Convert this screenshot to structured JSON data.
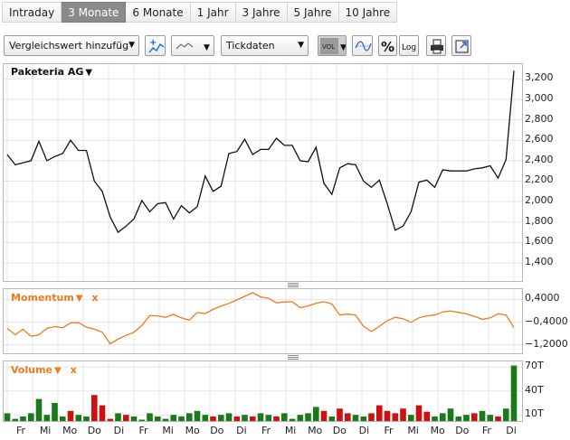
{
  "tabs": [
    {
      "label": "Intraday",
      "active": false
    },
    {
      "label": "3 Monate",
      "active": true
    },
    {
      "label": "6 Monate",
      "active": false
    },
    {
      "label": "1 Jahr",
      "active": false
    },
    {
      "label": "3 Jahre",
      "active": false
    },
    {
      "label": "5 Jahre",
      "active": false
    },
    {
      "label": "10 Jahre",
      "active": false
    }
  ],
  "toolbar": {
    "compare_label": "Vergleichswert hinzufüg",
    "tick_label": "Tickdaten",
    "vol_label": "VOL",
    "log_label": "Log",
    "percent_label": "%"
  },
  "colors": {
    "price_line": "#111111",
    "momentum_line": "#f07a1a",
    "label_orange": "#f07a1a",
    "vol_up": "#1a7a1a",
    "vol_down": "#cc1111",
    "grid": "#e5e5e5"
  },
  "chart_data": [
    {
      "panel": "price",
      "type": "line",
      "title": "Paketeria AG",
      "ylim": [
        1250,
        3300
      ],
      "yticks": [
        "3,200",
        "3,000",
        "2,800",
        "2,600",
        "2,400",
        "2,200",
        "2,000",
        "1,800",
        "1,600",
        "1,400"
      ],
      "ytick_values": [
        3200,
        3000,
        2800,
        2600,
        2400,
        2200,
        2000,
        1800,
        1600,
        1400
      ],
      "values": [
        2460,
        2360,
        2380,
        2400,
        2590,
        2400,
        2440,
        2470,
        2600,
        2500,
        2500,
        2200,
        2100,
        1850,
        1700,
        1760,
        1830,
        2010,
        1900,
        1980,
        1990,
        1830,
        1960,
        1890,
        1950,
        2250,
        2100,
        2150,
        2470,
        2490,
        2610,
        2460,
        2510,
        2510,
        2620,
        2550,
        2550,
        2400,
        2390,
        2530,
        2180,
        2070,
        2330,
        2370,
        2360,
        2200,
        2140,
        2210,
        1980,
        1720,
        1760,
        1900,
        2190,
        2210,
        2140,
        2310,
        2300,
        2300,
        2300,
        2320,
        2330,
        2350,
        2230,
        2410,
        3280
      ]
    },
    {
      "panel": "momentum",
      "type": "line",
      "title": "Momentum",
      "x_label": "x",
      "ylim": [
        -1500,
        700
      ],
      "yticks": [
        "0,4000",
        "−0,4000",
        "−1,2000"
      ],
      "ytick_values": [
        400,
        -400,
        -1200
      ],
      "values": [
        -620,
        -850,
        -650,
        -900,
        -850,
        -620,
        -560,
        -600,
        -430,
        -420,
        -580,
        -650,
        -760,
        -1170,
        -1000,
        -870,
        -760,
        -520,
        -170,
        -180,
        -230,
        -130,
        -250,
        -330,
        -60,
        -100,
        50,
        160,
        260,
        380,
        510,
        640,
        490,
        440,
        280,
        310,
        320,
        110,
        170,
        260,
        320,
        240,
        -150,
        -120,
        -150,
        -550,
        -730,
        -550,
        -350,
        -230,
        -280,
        -410,
        -250,
        -180,
        -150,
        -40,
        -5,
        -60,
        -110,
        -200,
        -300,
        -250,
        -110,
        -150,
        -590
      ]
    },
    {
      "panel": "volume",
      "type": "bar",
      "title": "Volume",
      "x_label": "x",
      "ylim": [
        0,
        75
      ],
      "yticks": [
        "70T",
        "40T",
        "10T"
      ],
      "ytick_values": [
        70,
        40,
        10
      ],
      "values": [
        12,
        5,
        8,
        12,
        30,
        10,
        25,
        8,
        15,
        10,
        8,
        35,
        22,
        5,
        12,
        10,
        8,
        4,
        12,
        8,
        5,
        10,
        8,
        12,
        15,
        10,
        8,
        10,
        12,
        8,
        10,
        8,
        12,
        10,
        8,
        12,
        5,
        10,
        12,
        20,
        15,
        8,
        18,
        12,
        10,
        8,
        12,
        22,
        15,
        12,
        18,
        10,
        22,
        14,
        8,
        12,
        18,
        8,
        10,
        12,
        15,
        10,
        8,
        18,
        72
      ],
      "up": [
        true,
        true,
        true,
        true,
        true,
        true,
        true,
        true,
        false,
        true,
        true,
        false,
        false,
        false,
        true,
        false,
        true,
        true,
        true,
        true,
        true,
        true,
        true,
        true,
        true,
        true,
        false,
        true,
        true,
        false,
        true,
        false,
        true,
        true,
        false,
        true,
        true,
        true,
        true,
        true,
        false,
        true,
        false,
        false,
        true,
        true,
        false,
        false,
        false,
        false,
        false,
        true,
        false,
        false,
        true,
        true,
        true,
        true,
        true,
        false,
        true,
        true,
        false,
        true,
        true
      ]
    },
    {
      "panel": "xaxis",
      "labels": [
        "Fr",
        "Mi",
        "Mo",
        "Do",
        "Di",
        "Fr",
        "Mi",
        "Mo",
        "Do",
        "Di",
        "Fr",
        "Mi",
        "Mo",
        "Do",
        "Di",
        "Fr",
        "Mi",
        "Mo",
        "Do",
        "Fr",
        "Di"
      ]
    }
  ]
}
